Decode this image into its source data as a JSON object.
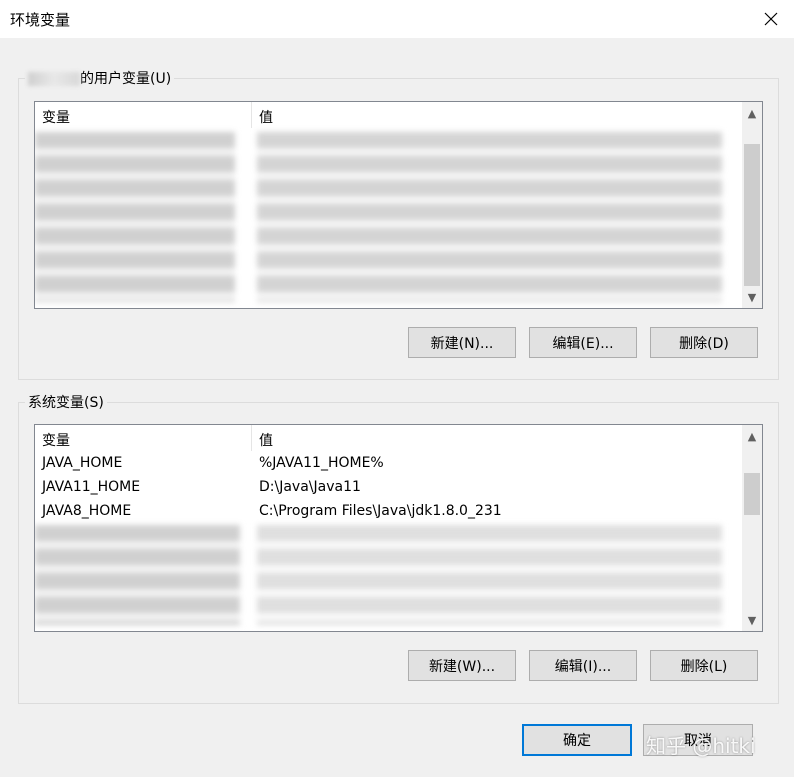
{
  "window": {
    "title": "环境变量"
  },
  "user_vars": {
    "legend": "的用户变量(U)",
    "header": {
      "name": "变量",
      "value": "值"
    },
    "new_label": "新建(N)...",
    "edit_label": "编辑(E)...",
    "delete_label": "删除(D)"
  },
  "system_vars": {
    "legend": "系统变量(S)",
    "header": {
      "name": "变量",
      "value": "值"
    },
    "rows": [
      {
        "name": "JAVA_HOME",
        "value": "%JAVA11_HOME%"
      },
      {
        "name": "JAVA11_HOME",
        "value": "D:\\Java\\Java11"
      },
      {
        "name": "JAVA8_HOME",
        "value": "C:\\Program Files\\Java\\jdk1.8.0_231"
      }
    ],
    "new_label": "新建(W)...",
    "edit_label": "编辑(I)...",
    "delete_label": "删除(L)"
  },
  "footer": {
    "ok_label": "确定",
    "cancel_label": "取消"
  },
  "watermark": "知乎 @hitki",
  "icons": {
    "close": "close-icon",
    "scroll_up": "chevron-up-icon",
    "scroll_down": "chevron-down-icon"
  }
}
